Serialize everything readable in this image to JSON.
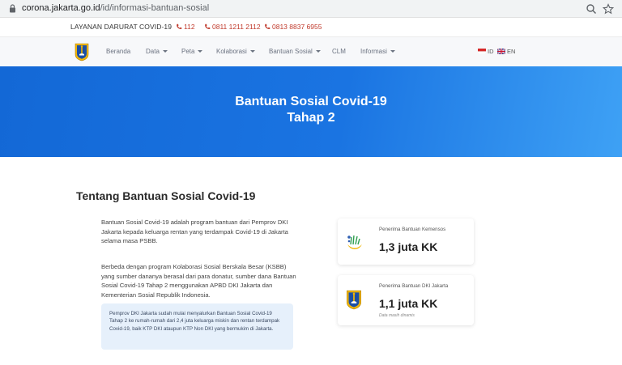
{
  "browser": {
    "url_host": "corona.jakarta.go.id",
    "url_path": "/id/informasi-bantuan-sosial"
  },
  "emergency": {
    "title": "LAYANAN DARURAT COVID-19",
    "phones": [
      "112",
      "0811 1211 2112",
      "0813 8837 6955"
    ]
  },
  "nav": {
    "items": [
      "Beranda",
      "Data",
      "Peta",
      "Kolaborasi",
      "Bantuan Sosial",
      "CLM",
      "Informasi"
    ],
    "lang_id": "ID",
    "lang_en": "EN"
  },
  "hero": {
    "title_line1": "Bantuan Sosial Covid-19",
    "title_line2": "Tahap 2"
  },
  "about": {
    "heading": "Tentang Bantuan Sosial Covid-19",
    "paragraph1": "Bantuan Sosial Covid-19 adalah program bantuan dari Pemprov DKI Jakarta kepada keluarga rentan yang terdampak Covid-19 di Jakarta selama masa PSBB.",
    "paragraph2": "Berbeda dengan program Kolaborasi Sosial Berskala Besar (KSBB) yang sumber dananya berasal dari para donatur, sumber dana Bantuan Sosial Covid-19 Tahap 2 menggunakan APBD DKI Jakarta dan Kementerian Sosial Republik Indonesia.",
    "info": "Pemprov DKI Jakarta sudah mulai menyalurkan Bantuan Sosial Covid-19 Tahap 2 ke rumah-rumah dari 2,4 juta keluarga miskin dan rentan terdampak Covid-19, baik KTP DKI ataupun KTP Non DKI yang bermukim di Jakarta."
  },
  "cards": [
    {
      "label": "Penerima Bantuan Kemensos",
      "value": "1,3 juta KK",
      "icon": "kemensos-logo-icon"
    },
    {
      "label": "Penerima Bantuan DKI Jakarta",
      "value": "1,1 juta KK",
      "note": "Data masih dinamis",
      "icon": "dki-jakarta-emblem-icon"
    }
  ],
  "colors": {
    "hero_start": "#1368d6",
    "hero_end": "#3ea1f5",
    "phone_red": "#c0392b",
    "info_bg": "#e6f0fb"
  }
}
